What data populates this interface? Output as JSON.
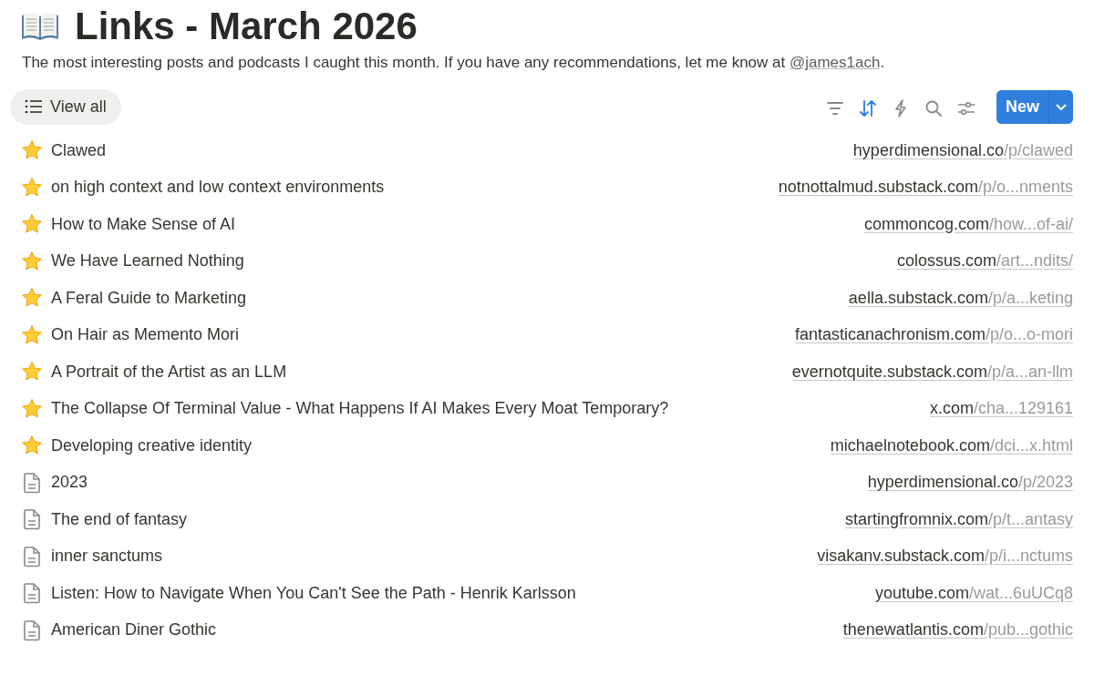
{
  "page": {
    "title": "Links - March 2026",
    "description": "The most interesting posts and podcasts I caught this month. If you have any recommendations, let me know at",
    "handle": "@james1ach",
    "after_handle": "."
  },
  "view": {
    "label": "View all"
  },
  "toolbar": [
    {
      "kind": "filter",
      "selected": false
    },
    {
      "kind": "sort",
      "selected": true
    },
    {
      "kind": "automation",
      "selected": false
    },
    {
      "kind": "search",
      "selected": false
    },
    {
      "kind": "settings",
      "selected": false
    }
  ],
  "new_button": {
    "label": "New"
  },
  "rows": [
    {
      "kind": "starred",
      "title": "Clawed",
      "domain": "hyperdimensional.co",
      "path": "/p/clawed"
    },
    {
      "kind": "starred",
      "title": "on high context and low context environments",
      "domain": "notnottalmud.substack.com",
      "path": "/p/o...nments"
    },
    {
      "kind": "starred",
      "title": "How to Make Sense of AI",
      "domain": "commoncog.com",
      "path": "/how...of-ai/"
    },
    {
      "kind": "starred",
      "title": "We Have Learned Nothing",
      "domain": "colossus.com",
      "path": "/art...ndits/"
    },
    {
      "kind": "starred",
      "title": "A Feral Guide to Marketing",
      "domain": "aella.substack.com",
      "path": "/p/a...keting"
    },
    {
      "kind": "starred",
      "title": "On Hair as Memento Mori",
      "domain": "fantasticanachronism.com",
      "path": "/p/o...o-mori"
    },
    {
      "kind": "starred",
      "title": "A Portrait of the Artist as an LLM",
      "domain": "evernotquite.substack.com",
      "path": "/p/a...an-llm"
    },
    {
      "kind": "starred",
      "title": "The Collapse Of Terminal Value - What Happens If AI Makes Every Moat Temporary?",
      "domain": "x.com",
      "path": "/cha...129161"
    },
    {
      "kind": "starred",
      "title": "Developing creative identity",
      "domain": "michaelnotebook.com",
      "path": "/dci...x.html"
    },
    {
      "kind": "page",
      "title": "2023",
      "domain": "hyperdimensional.co",
      "path": "/p/2023"
    },
    {
      "kind": "page",
      "title": "The end of fantasy",
      "domain": "startingfromnix.com",
      "path": "/p/t...antasy"
    },
    {
      "kind": "page",
      "title": "inner sanctums",
      "domain": "visakanv.substack.com",
      "path": "/p/i...nctums"
    },
    {
      "kind": "page",
      "title": "Listen: How to Navigate When You Can't See the Path - Henrik Karlsson",
      "domain": "youtube.com",
      "path": "/wat...6uUCq8"
    },
    {
      "kind": "page",
      "title": "American Diner Gothic",
      "domain": "thenewatlantis.com",
      "path": "/pub...gothic"
    }
  ]
}
